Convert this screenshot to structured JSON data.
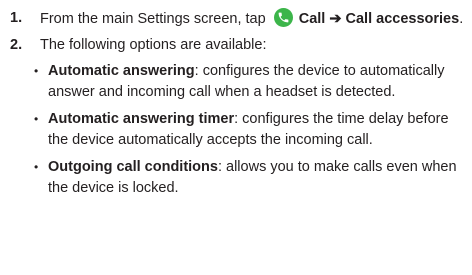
{
  "step1": {
    "number": "1.",
    "text_before_icon": "From the main Settings screen, tap",
    "icon": "phone-call-icon",
    "icon_color": "#3cb54a",
    "path_bold": "Call ➔ Call accessories",
    "period": "."
  },
  "step2": {
    "number": "2.",
    "text": "The following options are available:"
  },
  "options": [
    {
      "bullet": "•",
      "title": "Automatic answering",
      "description": ": configures the device to automatically answer and incoming call when a headset is detected."
    },
    {
      "bullet": "•",
      "title": "Automatic answering timer",
      "description": ": configures the time delay before the device automatically accepts the incoming call."
    },
    {
      "bullet": "•",
      "title": "Outgoing call conditions",
      "description": ": allows you to make calls even when the device is locked."
    }
  ]
}
